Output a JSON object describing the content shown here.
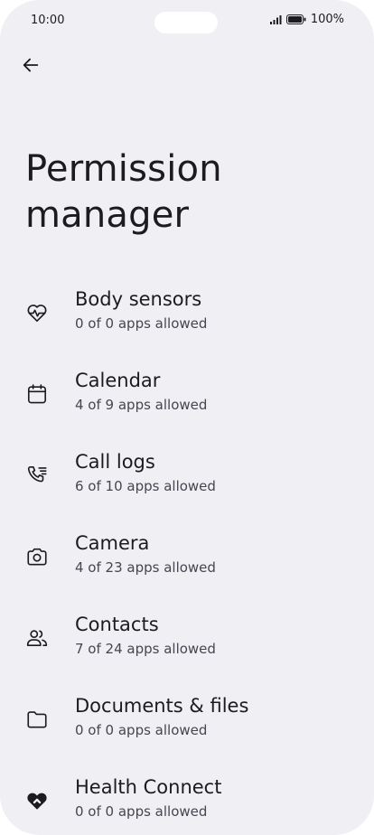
{
  "status_bar": {
    "time": "10:00",
    "battery": "100%"
  },
  "header": {
    "back_icon": "arrow-back-icon",
    "title": "Permission manager"
  },
  "permissions": [
    {
      "label": "Body sensors",
      "summary": "0 of 0 apps allowed",
      "icon": "heart-pulse-icon"
    },
    {
      "label": "Calendar",
      "summary": "4 of 9 apps allowed",
      "icon": "calendar-icon"
    },
    {
      "label": "Call logs",
      "summary": "6 of 10 apps allowed",
      "icon": "call-log-icon"
    },
    {
      "label": "Camera",
      "summary": "4 of 23 apps allowed",
      "icon": "camera-icon"
    },
    {
      "label": "Contacts",
      "summary": "7 of 24 apps allowed",
      "icon": "contacts-icon"
    },
    {
      "label": "Documents & files",
      "summary": "0 of 0 apps allowed",
      "icon": "folder-icon"
    },
    {
      "label": "Health Connect",
      "summary": "0 of 0 apps allowed",
      "icon": "health-connect-icon"
    }
  ]
}
